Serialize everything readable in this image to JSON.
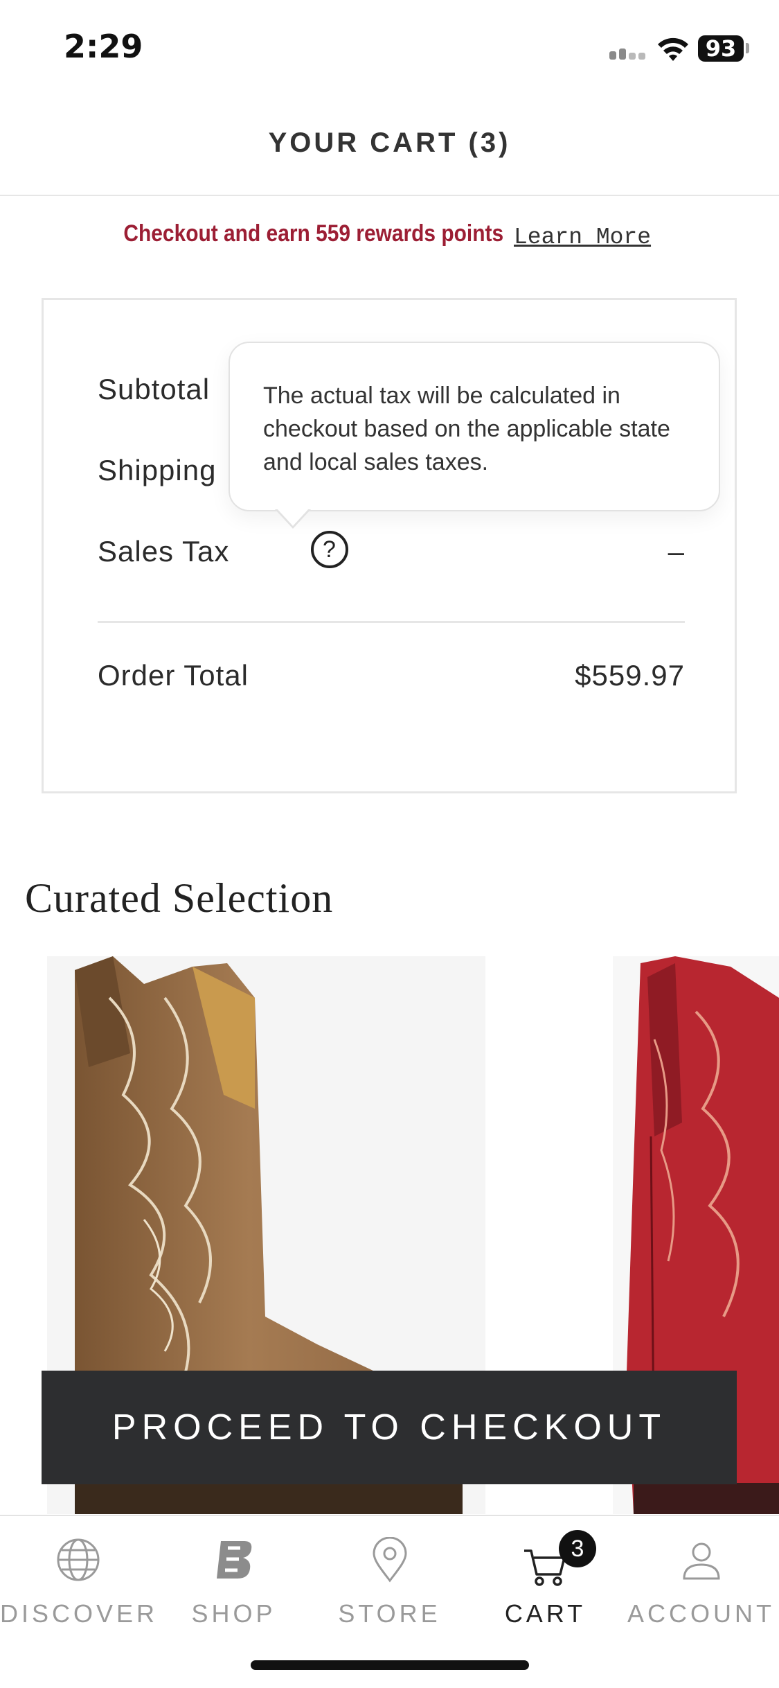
{
  "status_bar": {
    "time": "2:29",
    "battery": "93"
  },
  "header": {
    "title": "YOUR CART (3)"
  },
  "rewards": {
    "text": "Checkout and earn 559 rewards points",
    "link": "Learn More"
  },
  "summary": {
    "subtotal_label": "Subtotal",
    "shipping_label": "Shipping",
    "sales_tax_label": "Sales Tax",
    "sales_tax_value": "–",
    "help_icon_glyph": "?",
    "order_total_label": "Order Total",
    "order_total_value": "$559.97"
  },
  "tooltip": {
    "text": "The actual tax will be calculated in checkout based on the applicable state and local sales taxes."
  },
  "curated": {
    "title": "Curated Selection"
  },
  "checkout": {
    "label": "PROCEED TO CHECKOUT"
  },
  "tabbar": {
    "items": [
      {
        "label": "DISCOVER",
        "icon": "globe-icon"
      },
      {
        "label": "SHOP",
        "icon": "brand-logo-icon"
      },
      {
        "label": "STORE",
        "icon": "location-pin-icon"
      },
      {
        "label": "CART",
        "icon": "cart-icon",
        "badge": "3",
        "active": true
      },
      {
        "label": "ACCOUNT",
        "icon": "person-icon"
      }
    ]
  },
  "colors": {
    "accent": "#9c1e34",
    "button": "#2d2e30"
  }
}
